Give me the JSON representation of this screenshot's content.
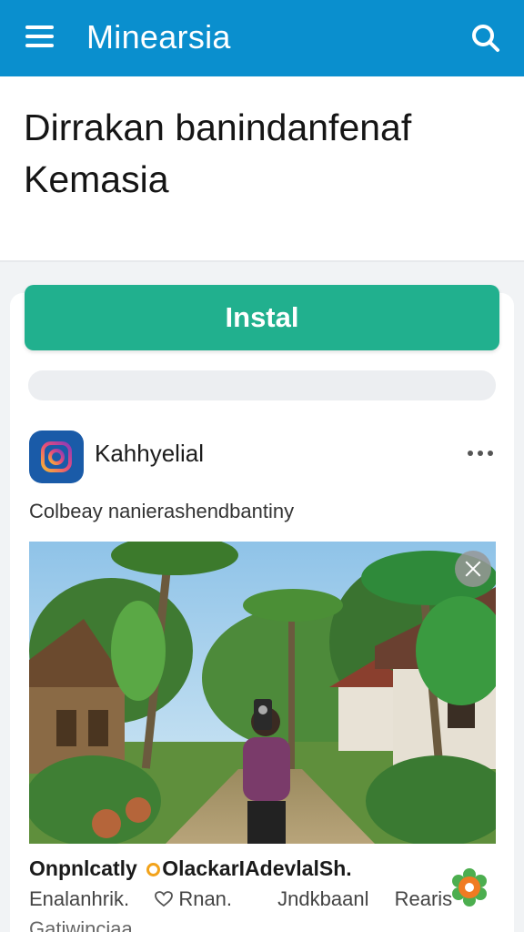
{
  "appbar": {
    "title": "Minearsia",
    "menu_icon": "hamburger-menu-icon",
    "search_icon": "search-icon"
  },
  "headline": "Dirrakan banindanfenaf Kemasia",
  "install": {
    "label": "Instal"
  },
  "post": {
    "app_name": "Kahhyelial",
    "subtitle": "Colbeay nanierashendbantiny",
    "caption_part1": "Onpnlcatly",
    "caption_part2": "OlackarIAdevlalSh.",
    "meta": [
      "Enalanhrik.",
      "Rnan.",
      "Jndkbaanl",
      "Rearis"
    ],
    "footer": "Gatiwinciaa"
  },
  "colors": {
    "appbar": "#0a8fce",
    "install": "#21b08e",
    "app_icon": "#1a5ba8",
    "accent_orange": "#f2a31b"
  }
}
